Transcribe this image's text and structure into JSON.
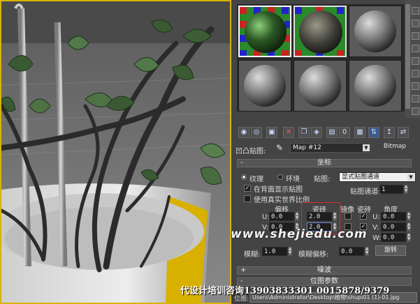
{
  "material_editor": {
    "map_label": "凹凸贴图:",
    "map_name": "Map #12",
    "map_type": "Bitmap",
    "rollouts": {
      "coordinates": "坐标",
      "noise": "噪波",
      "bitmap_params": "位图参数"
    },
    "mapping": {
      "texture_label": "纹理",
      "env_label": "环境",
      "map_label": "贴图:",
      "map_value": "显式贴图通道",
      "show_on_back": "在背面显示贴图",
      "map_channel_label": "贴图通道:",
      "map_channel_value": "1",
      "real_world": "使用真实世界比例"
    },
    "columns": {
      "offset": "偏移",
      "tiling": "瓷砖",
      "mirror": "镜像",
      "tile": "瓷砖",
      "angle": "角度"
    },
    "rows": [
      {
        "axis": "U:",
        "offset": "0.0",
        "tiling": "2.0",
        "angle_axis": "U:",
        "angle": "0.0"
      },
      {
        "axis": "V:",
        "offset": "0.0",
        "tiling": "2.0",
        "angle_axis": "V:",
        "angle": "0.0"
      },
      {
        "angle_axis": "W:",
        "angle": "0.0"
      }
    ],
    "blur_label": "模糊:",
    "blur_value": "1.0",
    "blur_offset_label": "模糊偏移:",
    "blur_offset_value": "0.0",
    "rotate_button": "旋转",
    "path_label": "位图:",
    "path_value": "Users\\Administrator\\Desktop\\植物\\shupi01 (1)-01.jpg"
  },
  "overlay": {
    "watermark": "www.shejiedu.com",
    "ad_text": "代设计培训咨询13903833301 0015878/9379"
  },
  "icons": {
    "toolbar": [
      "get-material-icon",
      "put-to-scene-icon",
      "assign-icon",
      "reset-icon",
      "copy-icon",
      "unique-icon",
      "put-to-library-icon",
      "material-id-icon",
      "show-map-icon",
      "show-end-result-icon",
      "go-parent-icon",
      "go-sibling-icon"
    ],
    "eyedropper": "eyedropper-icon"
  }
}
